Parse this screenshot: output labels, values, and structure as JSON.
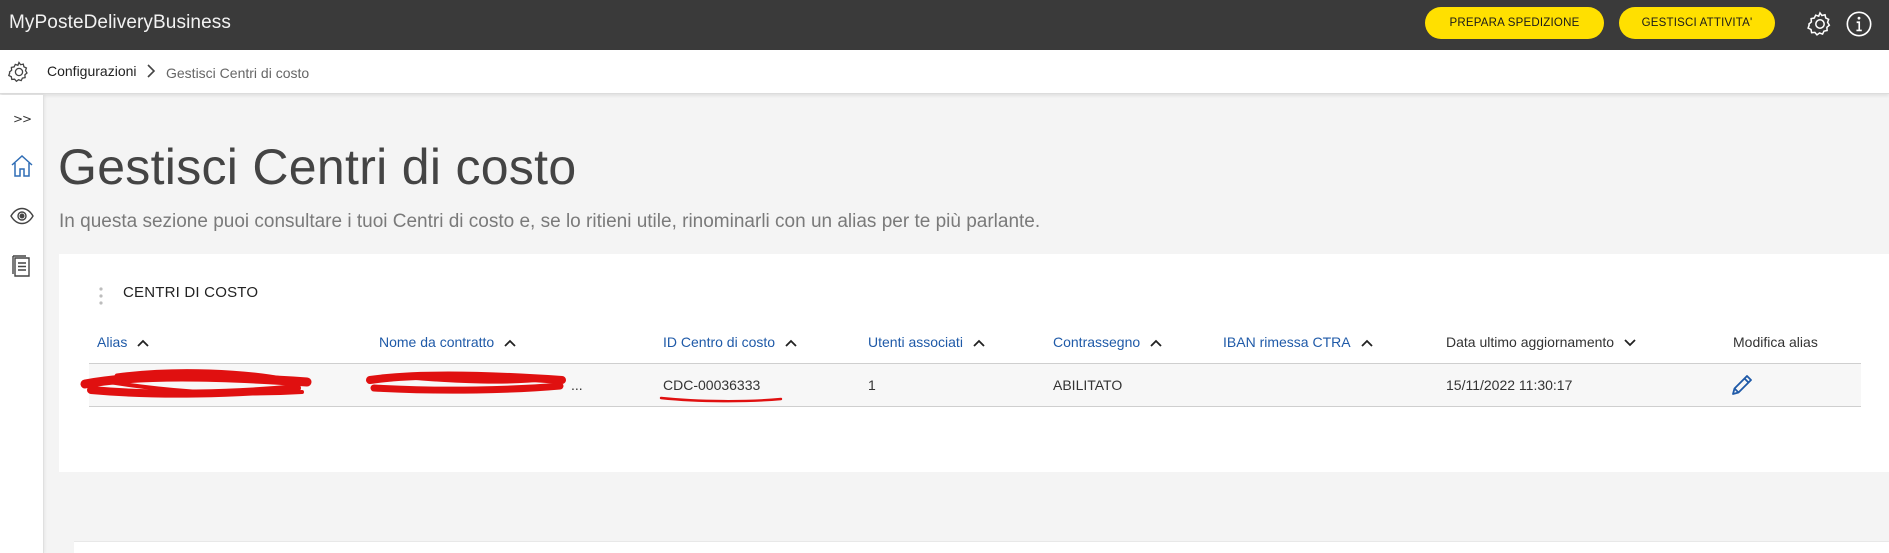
{
  "app": {
    "title": "MyPosteDeliveryBusiness"
  },
  "header": {
    "buttons": [
      {
        "label": "PREPARA SPEDIZIONE"
      },
      {
        "label": "GESTISCI ATTIVITA'"
      }
    ]
  },
  "breadcrumb": {
    "items": [
      "Configurazioni",
      "Gestisci Centri di costo"
    ]
  },
  "sidebar": {
    "expand_label": ">>"
  },
  "page": {
    "title": "Gestisci Centri di costo",
    "subtitle": "In questa sezione puoi consultare i tuoi Centri di costo e, se lo ritieni utile, rinominarli con un alias per te più parlante."
  },
  "table": {
    "title": "CENTRI DI COSTO",
    "columns": [
      {
        "label": "Alias",
        "sort": "asc"
      },
      {
        "label": "Nome da contratto",
        "sort": "asc"
      },
      {
        "label": "ID Centro di costo",
        "sort": "asc"
      },
      {
        "label": "Utenti associati",
        "sort": "asc"
      },
      {
        "label": "Contrassegno",
        "sort": "asc"
      },
      {
        "label": "IBAN rimessa CTRA",
        "sort": "asc"
      },
      {
        "label": "Data ultimo aggiornamento",
        "sort": "desc"
      },
      {
        "label": "Modifica alias",
        "sort": null
      }
    ],
    "rows": [
      {
        "alias": "",
        "nome_contratto": "...",
        "id_centro": "CDC-00036333",
        "utenti": "1",
        "contrassegno": "ABILITATO",
        "iban": "",
        "data": "15/11/2022 11:30:17"
      }
    ]
  },
  "colors": {
    "topbar": "#3a3a3a",
    "accent_yellow": "#ffe000",
    "link_blue": "#1f5aa8",
    "redaction_red": "#e01010"
  }
}
